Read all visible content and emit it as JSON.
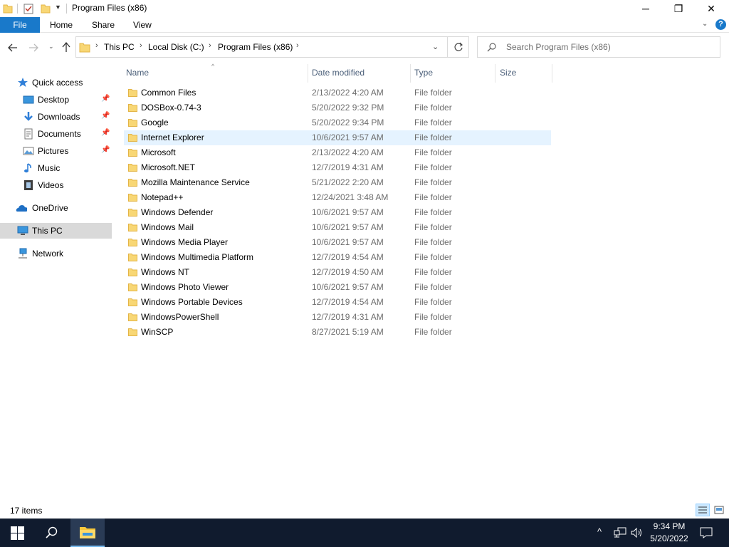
{
  "window": {
    "title": "Program Files (x86)",
    "minimize_glyph": "─",
    "maximize_glyph": "❐",
    "close_glyph": "✕"
  },
  "ribbon": {
    "tabs": [
      "File",
      "Home",
      "Share",
      "View"
    ],
    "help": "?",
    "collapse_glyph": "⌄"
  },
  "address": {
    "crumbs": [
      "This PC",
      "Local Disk (C:)",
      "Program Files (x86)"
    ],
    "separator": "›",
    "search_placeholder": "Search Program Files (x86)"
  },
  "nav": {
    "items": [
      {
        "label": "Quick access",
        "icon": "star-icon"
      },
      {
        "label": "Desktop",
        "icon": "desktop-icon",
        "pinned": true
      },
      {
        "label": "Downloads",
        "icon": "download-icon",
        "pinned": true
      },
      {
        "label": "Documents",
        "icon": "documents-icon",
        "pinned": true
      },
      {
        "label": "Pictures",
        "icon": "pictures-icon",
        "pinned": true
      },
      {
        "label": "Music",
        "icon": "music-icon"
      },
      {
        "label": "Videos",
        "icon": "videos-icon"
      },
      {
        "label": "OneDrive",
        "icon": "onedrive-icon"
      },
      {
        "label": "This PC",
        "icon": "this-pc-icon",
        "selected": true
      },
      {
        "label": "Network",
        "icon": "network-icon"
      }
    ]
  },
  "columns": {
    "name": "Name",
    "date": "Date modified",
    "type": "Type",
    "size": "Size"
  },
  "files": [
    {
      "name": "Common Files",
      "date": "2/13/2022 4:20 AM",
      "type": "File folder"
    },
    {
      "name": "DOSBox-0.74-3",
      "date": "5/20/2022 9:32 PM",
      "type": "File folder"
    },
    {
      "name": "Google",
      "date": "5/20/2022 9:34 PM",
      "type": "File folder"
    },
    {
      "name": "Internet Explorer",
      "date": "10/6/2021 9:57 AM",
      "type": "File folder"
    },
    {
      "name": "Microsoft",
      "date": "2/13/2022 4:20 AM",
      "type": "File folder"
    },
    {
      "name": "Microsoft.NET",
      "date": "12/7/2019 4:31 AM",
      "type": "File folder"
    },
    {
      "name": "Mozilla Maintenance Service",
      "date": "5/21/2022 2:20 AM",
      "type": "File folder"
    },
    {
      "name": "Notepad++",
      "date": "12/24/2021 3:48 AM",
      "type": "File folder"
    },
    {
      "name": "Windows Defender",
      "date": "10/6/2021 9:57 AM",
      "type": "File folder"
    },
    {
      "name": "Windows Mail",
      "date": "10/6/2021 9:57 AM",
      "type": "File folder"
    },
    {
      "name": "Windows Media Player",
      "date": "10/6/2021 9:57 AM",
      "type": "File folder"
    },
    {
      "name": "Windows Multimedia Platform",
      "date": "12/7/2019 4:54 AM",
      "type": "File folder"
    },
    {
      "name": "Windows NT",
      "date": "12/7/2019 4:50 AM",
      "type": "File folder"
    },
    {
      "name": "Windows Photo Viewer",
      "date": "10/6/2021 9:57 AM",
      "type": "File folder"
    },
    {
      "name": "Windows Portable Devices",
      "date": "12/7/2019 4:54 AM",
      "type": "File folder"
    },
    {
      "name": "WindowsPowerShell",
      "date": "12/7/2019 4:31 AM",
      "type": "File folder"
    },
    {
      "name": "WinSCP",
      "date": "8/27/2021 5:19 AM",
      "type": "File folder"
    }
  ],
  "status": {
    "item_count": "17 items"
  },
  "taskbar": {
    "time": "9:34 PM",
    "date": "5/20/2022"
  },
  "colors": {
    "accent": "#1979ca",
    "folder": "#f8d775",
    "folder_dark": "#e3b446",
    "taskbar": "#101b2e",
    "selection": "#d9d9d9",
    "hover": "#e5f3ff"
  }
}
